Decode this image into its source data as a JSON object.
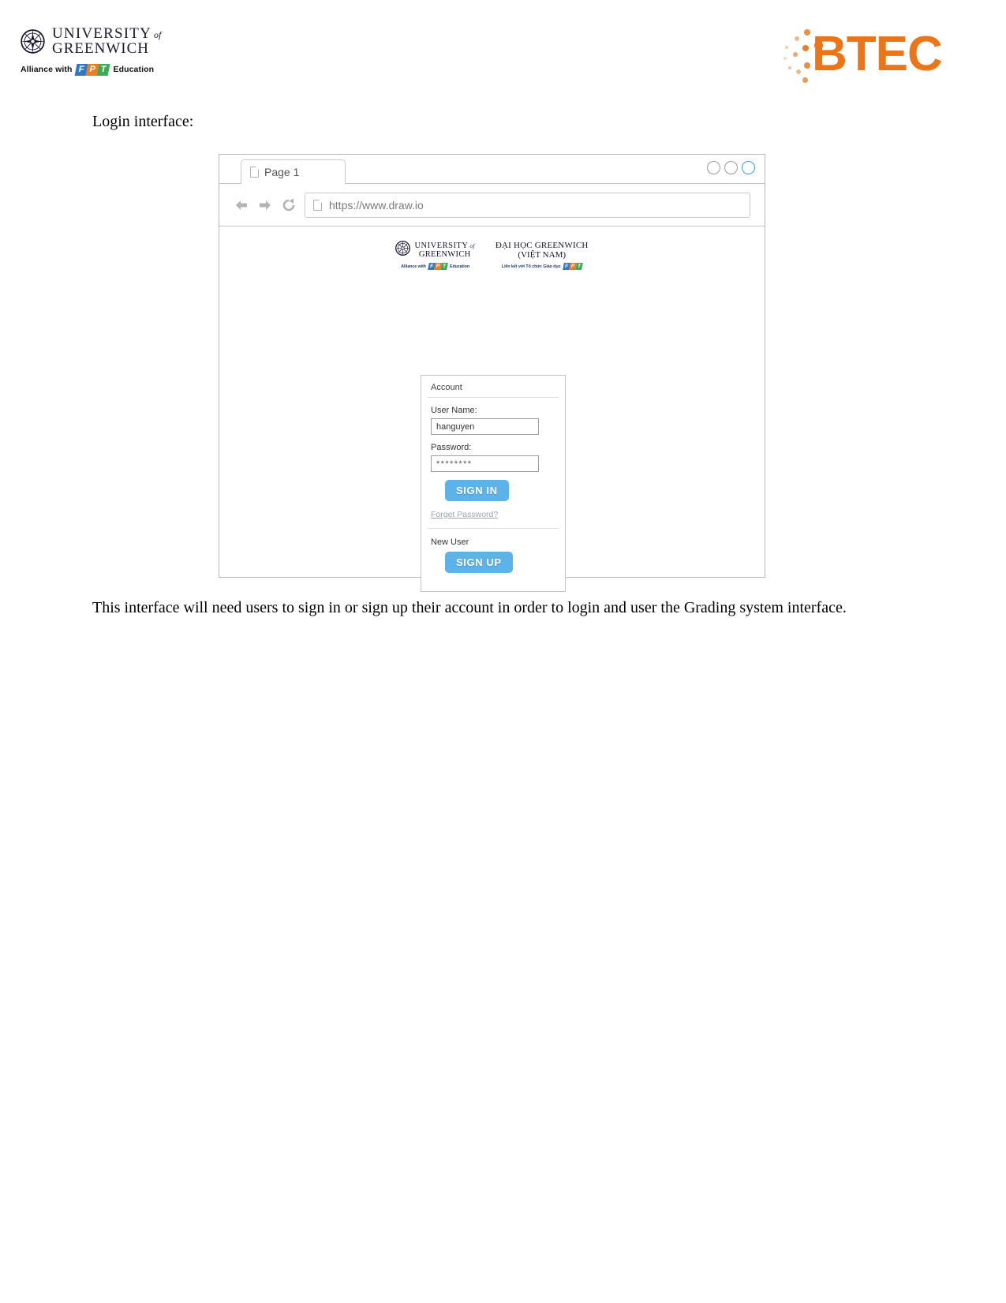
{
  "header": {
    "university": {
      "line1": "UNIVERSITY",
      "of": "of",
      "line2": "GREENWICH",
      "alliance_prefix": "Alliance with",
      "fpt_letters": [
        "F",
        "P",
        "T"
      ],
      "alliance_suffix": "Education",
      "crest_icon": "compass-rose-crest-icon"
    },
    "btec": {
      "wordmark": "BTEC",
      "color": "#ec7518",
      "dots_icon": "dot-spray-icon"
    }
  },
  "caption": "Login interface:",
  "mockup": {
    "tab": {
      "label": "Page 1",
      "icon": "page-document-icon"
    },
    "window_buttons": [
      {
        "name": "minimize-button",
        "style": "grey"
      },
      {
        "name": "maximize-button",
        "style": "grey"
      },
      {
        "name": "close-button",
        "style": "blue"
      }
    ],
    "toolbar": {
      "back_icon": "arrow-left-icon",
      "forward_icon": "arrow-right-icon",
      "reload_icon": "reload-icon",
      "favicon": "page-document-icon",
      "url": "https://www.draw.io"
    },
    "content": {
      "logo_en": {
        "line1": "UNIVERSITY",
        "of": "of",
        "line2": "GREENWICH",
        "tagline_prefix": "Alliance with",
        "tagline_suffix": "Education",
        "fpt_letters": [
          "F",
          "P",
          "T"
        ]
      },
      "logo_vn": {
        "line1": "ĐẠI HỌC GREENWICH",
        "line2": "(VIỆT NAM)",
        "tagline": "Liên kết với Tổ chức Giáo dục",
        "fpt_letters": [
          "F",
          "P",
          "T"
        ]
      },
      "form": {
        "title": "Account",
        "username_label": "User Name:",
        "username_value": "hanguyen",
        "password_label": "Password:",
        "password_value": "********",
        "sign_in_label": "SIGN IN",
        "forget_password_label": "Forget Password?",
        "new_user_label": "New User",
        "sign_up_label": "SIGN UP",
        "button_color": "#5cb3ea"
      }
    }
  },
  "paragraph": "This interface will need users to sign in or sign up their account in order to login and user the Grading system interface."
}
